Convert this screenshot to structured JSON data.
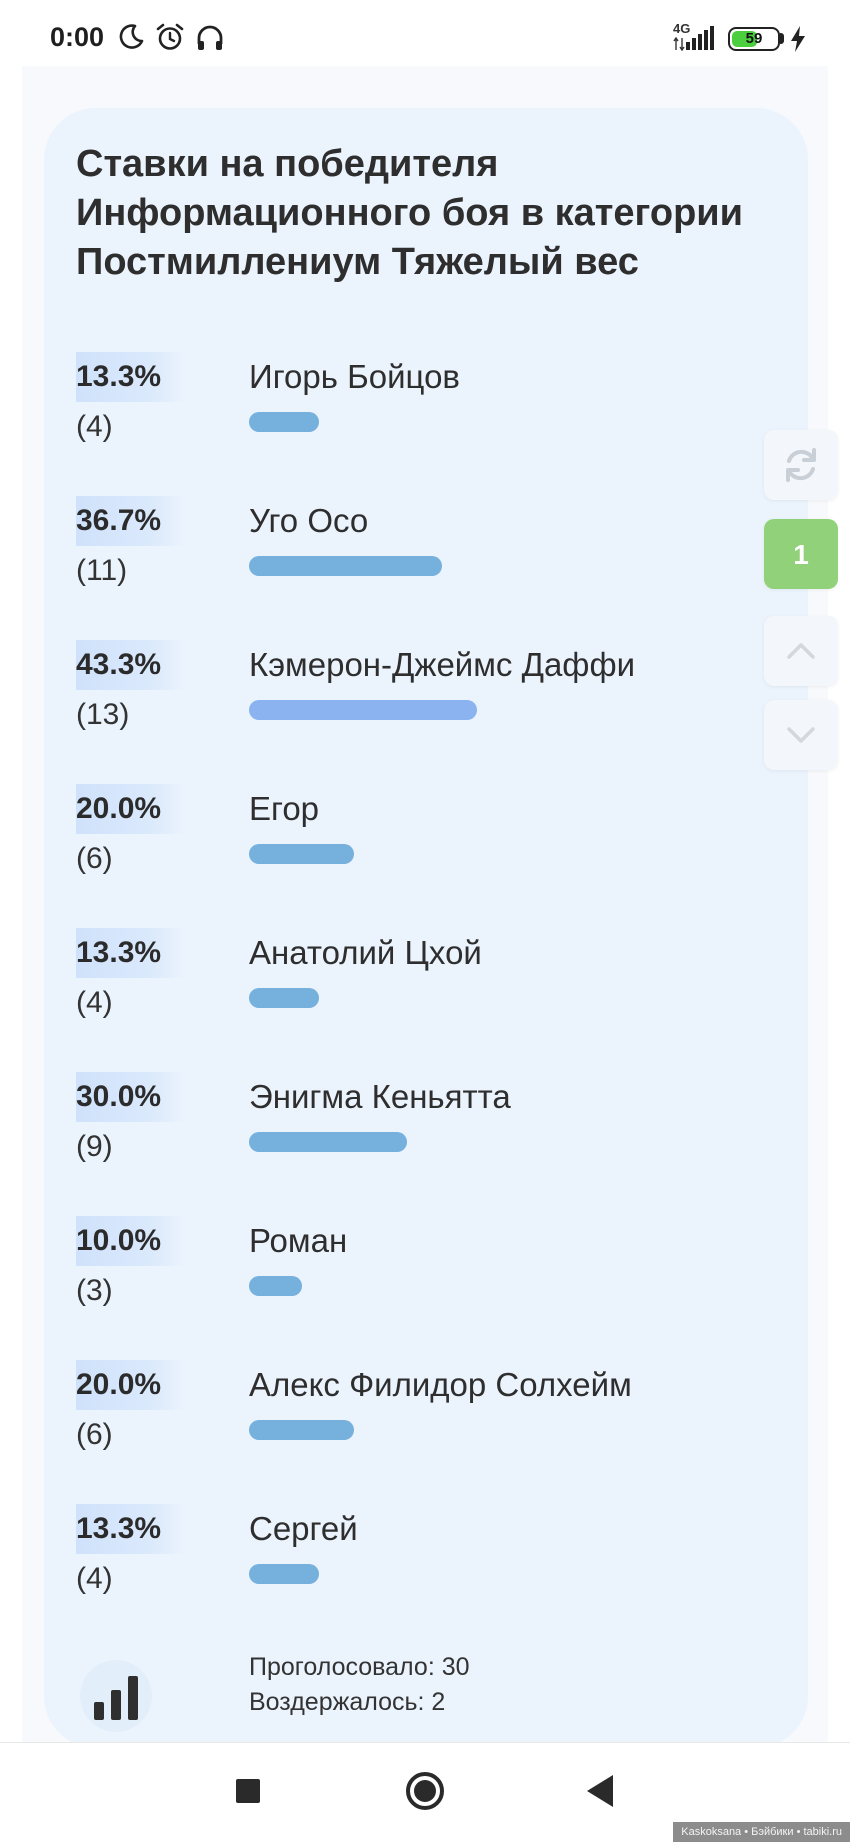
{
  "status_bar": {
    "time": "0:00",
    "network": "4G",
    "battery": "59",
    "battery_level": 0.59,
    "icons": [
      "moon-icon",
      "alarm-icon",
      "headphones-icon",
      "signal-icon",
      "battery-icon",
      "charging-icon"
    ]
  },
  "poll": {
    "title": "Ставки на победителя Информационного боя в категории Постмиллениум Тяжелый вес",
    "options": [
      {
        "percent": "13.3%",
        "count": "(4)",
        "label": "Игорь Бойцов"
      },
      {
        "percent": "36.7%",
        "count": "(11)",
        "label": "Уго Осо"
      },
      {
        "percent": "43.3%",
        "count": "(13)",
        "label": "Кэмерон-Джеймс Даффи"
      },
      {
        "percent": "20.0%",
        "count": "(6)",
        "label": "Егор"
      },
      {
        "percent": "13.3%",
        "count": "(4)",
        "label": "Анатолий Цхой"
      },
      {
        "percent": "30.0%",
        "count": "(9)",
        "label": "Энигма Кеньятта"
      },
      {
        "percent": "10.0%",
        "count": "(3)",
        "label": "Роман"
      },
      {
        "percent": "20.0%",
        "count": "(6)",
        "label": "Алекс Филидор Солхейм"
      },
      {
        "percent": "13.3%",
        "count": "(4)",
        "label": "Сергей"
      }
    ],
    "voted": "Проголосовало: 30",
    "abstained": "Воздержалось: 2"
  },
  "side_buttons": {
    "counter": "1",
    "icons": [
      "refresh-icon",
      "chevron-up-icon",
      "chevron-down-icon"
    ]
  },
  "nav_bar": {
    "icons": [
      "recent-apps-icon",
      "home-icon",
      "back-icon"
    ]
  },
  "colors": {
    "card_bg": "#ebf3fd",
    "bar": "#76b0dc",
    "bar_leading": "#8ab3ef",
    "counter_badge": "#91d17a"
  },
  "chart_data": {
    "type": "bar",
    "categories": [
      "Игорь Бойцов",
      "Уго Осо",
      "Кэмерон-Джеймс Даффи",
      "Егор",
      "Анатолий Цхой",
      "Энигма Кеньятта",
      "Роман",
      "Алекс Филидор Солхейм",
      "Сергей"
    ],
    "values": [
      13.3,
      36.7,
      43.3,
      20.0,
      13.3,
      30.0,
      10.0,
      20.0,
      13.3
    ],
    "counts": [
      4,
      11,
      13,
      6,
      4,
      9,
      3,
      6,
      4
    ]
  },
  "watermark": "Kaskoksana • Бэйбики • tabiki.ru"
}
